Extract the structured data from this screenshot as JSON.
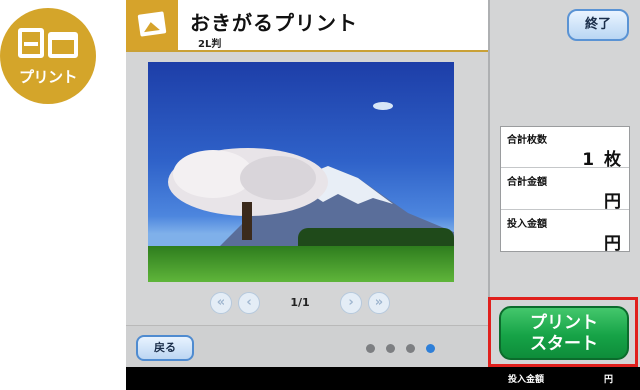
{
  "logo": {
    "text": "プリント",
    "icon": "print-logo-icon"
  },
  "header": {
    "title": "おきがるプリント",
    "subtitle": "2L判",
    "icon": "photo-icon"
  },
  "pager": {
    "page": "1/1",
    "first_icon": "double-chevron-left-icon",
    "prev_icon": "chevron-left-icon",
    "next_icon": "chevron-right-icon",
    "last_icon": "double-chevron-right-icon"
  },
  "buttons": {
    "back": "戻る",
    "end": "終了",
    "start_line1": "プリント",
    "start_line2": "スタート"
  },
  "summary": {
    "rows": [
      {
        "label": "合計枚数",
        "value": "1 枚"
      },
      {
        "label": "合計金額",
        "value": "円"
      },
      {
        "label": "投入金額",
        "value": "円"
      }
    ]
  },
  "footer": {
    "label": "投入金額",
    "unit": "円"
  },
  "steps": {
    "total": 4,
    "active": 4
  },
  "colors": {
    "accent_gold": "#d6a32b",
    "start_green": "#16a347",
    "highlight_red": "#e0201d",
    "step_active": "#2e7fd8"
  }
}
